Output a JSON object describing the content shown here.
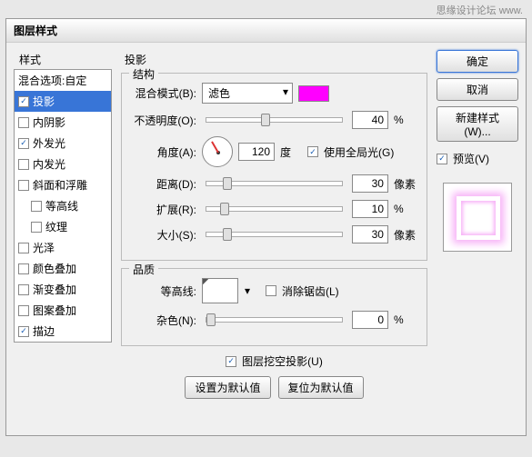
{
  "watermark": "思缘设计论坛  www.",
  "dialog_title": "图层样式",
  "styles_label": "样式",
  "blend_options": "混合选项:自定",
  "style_items": [
    {
      "label": "投影",
      "checked": true,
      "selected": true
    },
    {
      "label": "内阴影",
      "checked": false
    },
    {
      "label": "外发光",
      "checked": true
    },
    {
      "label": "内发光",
      "checked": false
    },
    {
      "label": "斜面和浮雕",
      "checked": false
    },
    {
      "label": "等高线",
      "checked": false,
      "indent": true
    },
    {
      "label": "纹理",
      "checked": false,
      "indent": true
    },
    {
      "label": "光泽",
      "checked": false
    },
    {
      "label": "颜色叠加",
      "checked": false
    },
    {
      "label": "渐变叠加",
      "checked": false
    },
    {
      "label": "图案叠加",
      "checked": false
    },
    {
      "label": "描边",
      "checked": true
    }
  ],
  "panel_title": "投影",
  "structure_legend": "结构",
  "blend_mode_label": "混合模式(B):",
  "blend_mode_value": "滤色",
  "color": "#ff00ff",
  "opacity_label": "不透明度(O):",
  "opacity_value": "40",
  "percent": "%",
  "angle_label": "角度(A):",
  "angle_value": "120",
  "angle_unit": "度",
  "global_light_label": "使用全局光(G)",
  "distance_label": "距离(D):",
  "distance_value": "30",
  "px_unit": "像素",
  "spread_label": "扩展(R):",
  "spread_value": "10",
  "size_label": "大小(S):",
  "size_value": "30",
  "quality_legend": "品质",
  "contour_label": "等高线:",
  "antialias_label": "消除锯齿(L)",
  "noise_label": "杂色(N):",
  "noise_value": "0",
  "knockout_label": "图层挖空投影(U)",
  "set_default": "设置为默认值",
  "reset_default": "复位为默认值",
  "ok": "确定",
  "cancel": "取消",
  "new_style": "新建样式(W)...",
  "preview_label": "预览(V)"
}
